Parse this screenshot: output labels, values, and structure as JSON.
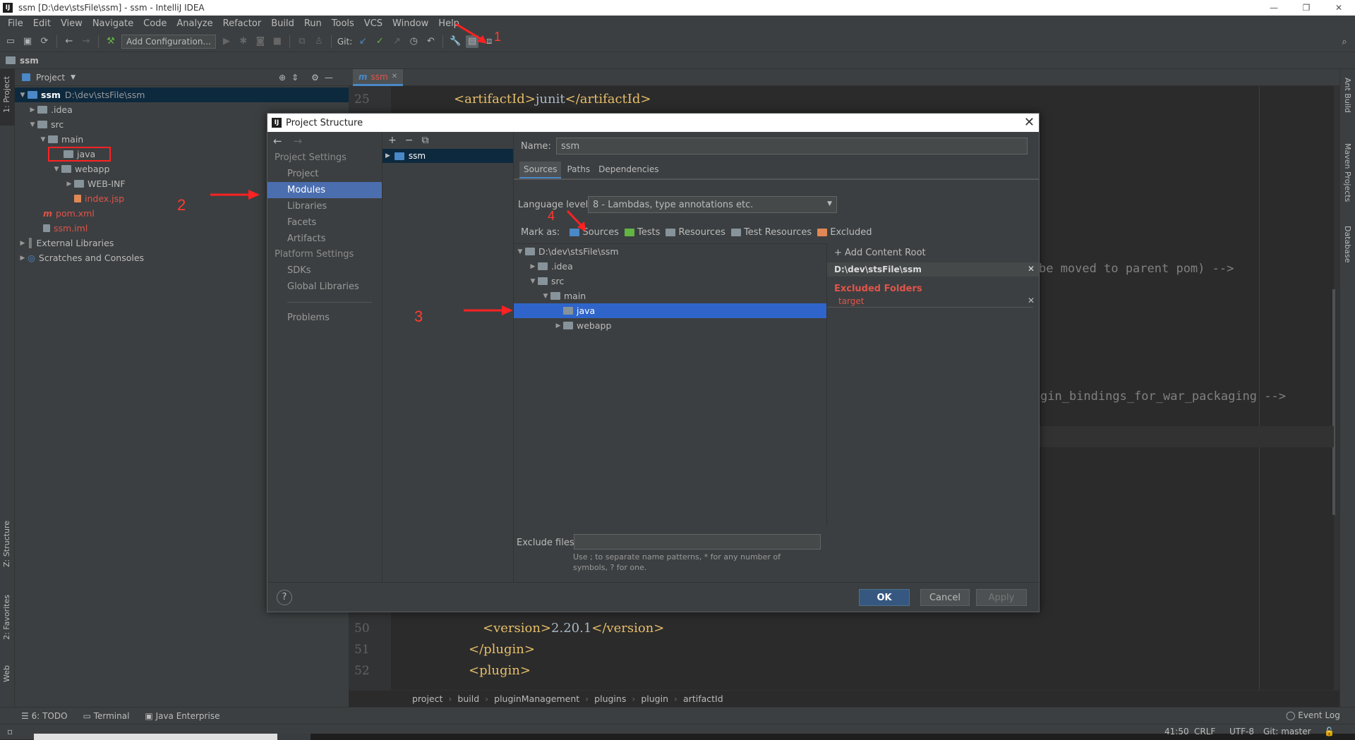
{
  "window": {
    "title": "ssm [D:\\dev\\stsFile\\ssm] - ssm - IntelliJ IDEA",
    "app_icon": "IJ"
  },
  "menu": [
    "File",
    "Edit",
    "View",
    "Navigate",
    "Code",
    "Analyze",
    "Refactor",
    "Build",
    "Run",
    "Tools",
    "VCS",
    "Window",
    "Help"
  ],
  "toolbar": {
    "add_configuration": "Add Configuration...",
    "git_label": "Git:"
  },
  "navbar": {
    "project": "ssm"
  },
  "left_stripe": {
    "project": "1: Project",
    "structure": "Z: Structure",
    "favorites": "2: Favorites",
    "web": "Web"
  },
  "right_stripe": {
    "ant": "Ant Build",
    "maven": "Maven Projects",
    "database": "Database"
  },
  "project_panel": {
    "header": "Project",
    "tree": [
      {
        "name": "ssm",
        "path": "D:\\dev\\stsFile\\ssm"
      },
      {
        "name": ".idea"
      },
      {
        "name": "src"
      },
      {
        "name": "main"
      },
      {
        "name": "java"
      },
      {
        "name": "webapp"
      },
      {
        "name": "WEB-INF"
      },
      {
        "name": "index.jsp"
      },
      {
        "name": "pom.xml"
      },
      {
        "name": "ssm.iml"
      },
      {
        "name": "External Libraries"
      },
      {
        "name": "Scratches and Consoles"
      }
    ]
  },
  "editor": {
    "tab": "ssm",
    "lines": [
      {
        "num": "25",
        "open": "<artifactId>",
        "value": "junit",
        "close": "</artifactId>"
      },
      {
        "num": "50",
        "open": "<version>",
        "value": "2.20.1",
        "close": "</version>"
      },
      {
        "num": "51",
        "open": "</plugin>",
        "value": "",
        "close": ""
      },
      {
        "num": "52",
        "open": "<plugin>",
        "value": "",
        "close": ""
      }
    ],
    "comment1": "be moved to parent pom) -->",
    "comment2": "gin_bindings_for_war_packaging -->"
  },
  "breadcrumbs": [
    "project",
    "build",
    "pluginManagement",
    "plugins",
    "plugin",
    "artifactId"
  ],
  "bottom_tools": {
    "todo": "6: TODO",
    "terminal": "Terminal",
    "java_ee": "Java Enterprise",
    "event_log": "Event Log"
  },
  "status": {
    "position": "41:50",
    "line_sep": "CRLF",
    "encoding": "UTF-8",
    "git": "Git: master"
  },
  "annotations": {
    "n1": "1",
    "n2": "2",
    "n3": "3",
    "n4": "4"
  },
  "dialog": {
    "title": "Project Structure",
    "project_settings": "Project Settings",
    "ps_items": [
      "Project",
      "Modules",
      "Libraries",
      "Facets",
      "Artifacts"
    ],
    "platform_settings": "Platform Settings",
    "pl_items": [
      "SDKs",
      "Global Libraries"
    ],
    "problems": "Problems",
    "module": "ssm",
    "name_label": "Name:",
    "name_value": "ssm",
    "tabs": [
      "Sources",
      "Paths",
      "Dependencies"
    ],
    "lang_label": "Language level:",
    "lang_value": "8 - Lambdas, type annotations etc.",
    "mark_as": "Mark as:",
    "marks": [
      "Sources",
      "Tests",
      "Resources",
      "Test Resources",
      "Excluded"
    ],
    "root_tree": [
      {
        "name": "D:\\dev\\stsFile\\ssm"
      },
      {
        "name": ".idea"
      },
      {
        "name": "src"
      },
      {
        "name": "main"
      },
      {
        "name": "java"
      },
      {
        "name": "webapp"
      }
    ],
    "add_root": "Add Content Root",
    "root_path": "D:\\dev\\stsFile\\ssm",
    "excluded_title": "Excluded Folders",
    "excluded_item": "target",
    "exclude_label": "Exclude files:",
    "exclude_hint1": "Use ; to separate name patterns, * for any number of",
    "exclude_hint2": "symbols, ? for one.",
    "help": "?",
    "ok": "OK",
    "cancel": "Cancel",
    "apply": "Apply"
  },
  "colors": {
    "accent": "#4b6eaf",
    "selection": "#2f65ca",
    "red": "#ff3b30",
    "excluded": "#e0544b"
  }
}
